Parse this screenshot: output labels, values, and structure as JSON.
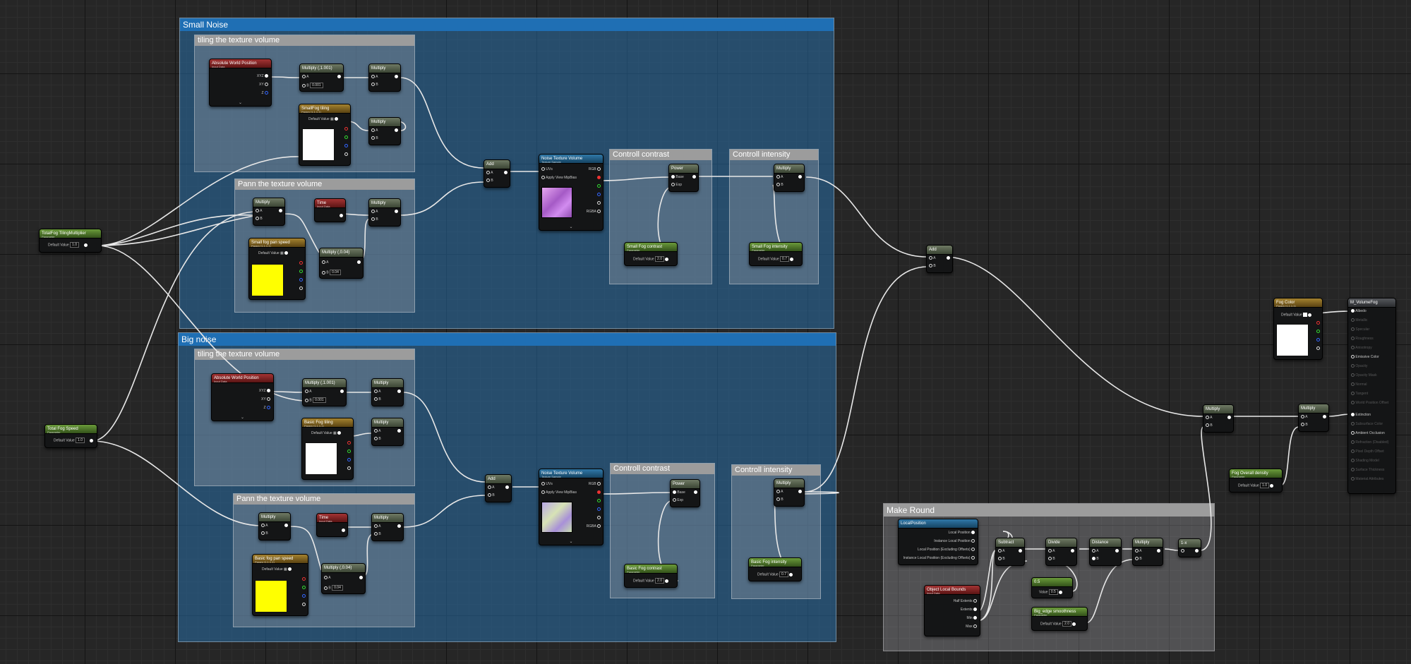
{
  "colors": {
    "comment_blue": "#1f6fb4",
    "comment_grey": "#9c9c9c",
    "wire": "#e8e8e8",
    "canvas": "#262626"
  },
  "comments": {
    "small_noise": "Small Noise",
    "small_tiling": "tiling the texture volume",
    "small_pann": "Pann the texture volume",
    "small_contrast": "Controll contrast",
    "small_intensity": "Controll intensity",
    "big_noise": "Big noise",
    "big_tiling": "tiling the texture volume",
    "big_pann": "Pann the texture volume",
    "big_contrast": "Controll contrast",
    "big_intensity": "Controll intensity",
    "make_round": "Make Round"
  },
  "nodes": {
    "total_fog_tiling": {
      "title": "TotalFog TilingMultiplier",
      "sub": "Parameter",
      "label": "Default Value",
      "value": "1.0"
    },
    "total_fog_speed": {
      "title": "Total Fog Speed",
      "sub": "Parameter",
      "label": "Default Value",
      "value": "1.0"
    },
    "s_awp": {
      "title": "Absolute World Position",
      "sub": "Input Data",
      "pins": [
        "XYZ",
        "XY",
        "Z"
      ]
    },
    "s_mul1": {
      "title": "Multiply (,1.001)",
      "a": "A",
      "b": "B",
      "bval": "0.001"
    },
    "s_mul2": {
      "title": "Multiply",
      "a": "A",
      "b": "B"
    },
    "s_tiling_param": {
      "title": "SmallFog tiling",
      "sub": "Param (1,1,1,1)",
      "label": "Default Value"
    },
    "s_mul3": {
      "title": "Multiply",
      "a": "A",
      "b": "B"
    },
    "s_add": {
      "title": "Add",
      "a": "A",
      "b": "B"
    },
    "s_mul4": {
      "title": "Multiply",
      "a": "A",
      "b": "B"
    },
    "s_time": {
      "title": "Time",
      "sub": "Input Data"
    },
    "s_mul5": {
      "title": "Multiply",
      "a": "A",
      "b": "B"
    },
    "s_pan_param": {
      "title": "Small fog pan speed",
      "sub": "Param (1,1,1,1)",
      "label": "Default Value"
    },
    "s_mul6": {
      "title": "Multiply (,0.04)",
      "a": "A",
      "b": "B",
      "bval": "0.04"
    },
    "s_noise": {
      "title": "Noise Texture Volume",
      "sub": "Texture Sample",
      "pins_in": [
        "UVs",
        "Apply View MipBias"
      ],
      "pins_out": [
        "RGB",
        "R",
        "G",
        "B",
        "A",
        "RGBA"
      ]
    },
    "s_power": {
      "title": "Power",
      "base": "Base",
      "exp": "Exp"
    },
    "s_contrast": {
      "title": "Small Fog contrast",
      "sub": "Parameter",
      "label": "Default Value",
      "value": "2.0"
    },
    "s_mul7": {
      "title": "Multiply",
      "a": "A",
      "b": "B"
    },
    "s_intensity": {
      "title": "Small Fog intensity",
      "sub": "Parameter",
      "label": "Default Value",
      "value": "0.7"
    },
    "b_awp": {
      "title": "Absolute World Position",
      "sub": "Input Data",
      "pins": [
        "XYZ",
        "XY",
        "Z"
      ]
    },
    "b_mul1": {
      "title": "Multiply (,1.001)",
      "a": "A",
      "b": "B",
      "bval": "0.001"
    },
    "b_mul2": {
      "title": "Multiply",
      "a": "A",
      "b": "B"
    },
    "b_tiling_param": {
      "title": "Basic Fog tiling",
      "sub": "Param (1,1,1,1)",
      "label": "Default Value"
    },
    "b_mul3": {
      "title": "Multiply",
      "a": "A",
      "b": "B"
    },
    "b_add": {
      "title": "Add",
      "a": "A",
      "b": "B"
    },
    "b_mul4": {
      "title": "Multiply",
      "a": "A",
      "b": "B"
    },
    "b_time": {
      "title": "Time",
      "sub": "Input Data"
    },
    "b_mul5": {
      "title": "Multiply",
      "a": "A",
      "b": "B"
    },
    "b_pan_param": {
      "title": "Basic fog pan speed",
      "sub": "Param (1,1,1,1)",
      "label": "Default Value"
    },
    "b_mul6": {
      "title": "Multiply (,0.04)",
      "a": "A",
      "b": "B",
      "bval": "0.04"
    },
    "b_noise": {
      "title": "Noise Texture Volume",
      "sub": "Texture Sample",
      "pins_in": [
        "UVs",
        "Apply View MipBias"
      ],
      "pins_out": [
        "RGB",
        "R",
        "G",
        "B",
        "A",
        "RGBA"
      ]
    },
    "b_power": {
      "title": "Power",
      "base": "Base",
      "exp": "Exp"
    },
    "b_contrast": {
      "title": "Basic Fog contrast",
      "sub": "Parameter",
      "label": "Default Value",
      "value": "2.0"
    },
    "b_mul7": {
      "title": "Multiply",
      "a": "A",
      "b": "B"
    },
    "b_intensity": {
      "title": "Basic Fog intensity",
      "sub": "Parameter",
      "label": "Default Value",
      "value": "0.7"
    },
    "add_main": {
      "title": "Add",
      "a": "A",
      "b": "B"
    },
    "mul_main": {
      "title": "Multiply",
      "a": "A",
      "b": "B"
    },
    "mul_final": {
      "title": "Multiply",
      "a": "A",
      "b": "B"
    },
    "overall_density": {
      "title": "Fog Overall density",
      "sub": "Parameter",
      "label": "Default Value",
      "value": "1.0"
    },
    "fog_color": {
      "title": "Fog Color",
      "sub": "Param (1,1,1,1)",
      "label": "Default Value"
    },
    "result": {
      "title": "M_VolumeFog",
      "pins": [
        "Albedo",
        "Metallic",
        "Specular",
        "Roughness",
        "Anisotropy",
        "Emissive Color",
        "Opacity",
        "Opacity Mask",
        "Normal",
        "Tangent",
        "World Position Offset",
        "Extinction",
        "Subsurface Color",
        "Ambient Occlusion",
        "Refraction (Disabled)",
        "Pixel Depth Offset",
        "Shading Model",
        "Surface Thickness",
        "Material Attributes"
      ]
    },
    "local_pos": {
      "title": "LocalPosition",
      "sub": "",
      "pins": [
        "Local Position",
        "Instance Local Position",
        "Local Position (Excluding Offsets)",
        "Instance Local Position (Excluding Offsets)"
      ]
    },
    "obj_bounds": {
      "title": "Object Local Bounds",
      "sub": "Input Data",
      "pins": [
        "Half Extents",
        "Extents",
        "Min",
        "Max"
      ]
    },
    "subtract": {
      "title": "Subtract",
      "a": "A",
      "b": "B"
    },
    "divide": {
      "title": "Divide",
      "a": "A",
      "b": "B"
    },
    "distance": {
      "title": "Distance",
      "a": "A",
      "b": "B"
    },
    "mr_mul": {
      "title": "Multiply",
      "a": "A",
      "b": "B"
    },
    "one_minus": {
      "title": "1-x"
    },
    "const_half": {
      "title": "0.5",
      "label": "Value",
      "value": "0.5"
    },
    "edge_smooth": {
      "title": "Big_edge smoothness",
      "sub": "Parameter",
      "label": "Default Value",
      "value": "2.0"
    }
  }
}
